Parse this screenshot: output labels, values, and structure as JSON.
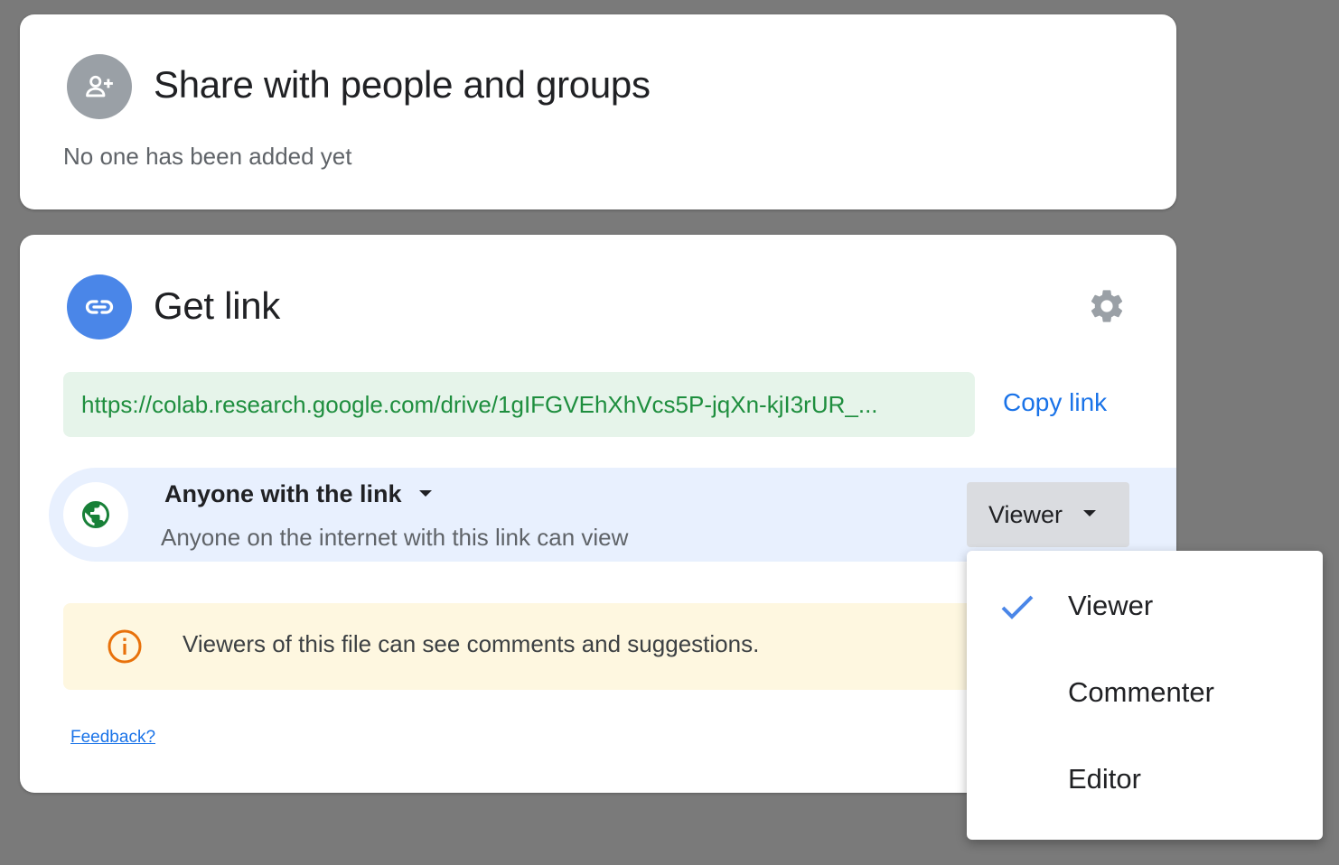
{
  "share": {
    "title": "Share with people and groups",
    "subtitle": "No one has been added yet",
    "icon": "person-add-icon"
  },
  "get_link": {
    "title": "Get link",
    "icon": "link-icon",
    "settings_icon": "gear-icon",
    "url": "https://colab.research.google.com/drive/1gIFGVEhXhVcs5P-jqXn-kjI3rUR_...",
    "copy_label": "Copy link",
    "access": {
      "scope_label": "Anyone with the link",
      "description": "Anyone on the internet with this link can view",
      "role_label": "Viewer"
    },
    "info": {
      "text": "Viewers of this file can see comments and suggestions."
    },
    "feedback_label": "Feedback?"
  },
  "role_menu": {
    "selected": "Viewer",
    "items": [
      {
        "label": "Viewer"
      },
      {
        "label": "Commenter"
      },
      {
        "label": "Editor"
      }
    ]
  },
  "colors": {
    "backdrop": "#7a7a7a",
    "accent_blue": "#1a73e8",
    "url_green": "#1e8e3e",
    "access_bg": "#e8f0fe",
    "info_bg": "#fef7e0",
    "info_orange": "#e8710a",
    "globe_green": "#188038"
  }
}
